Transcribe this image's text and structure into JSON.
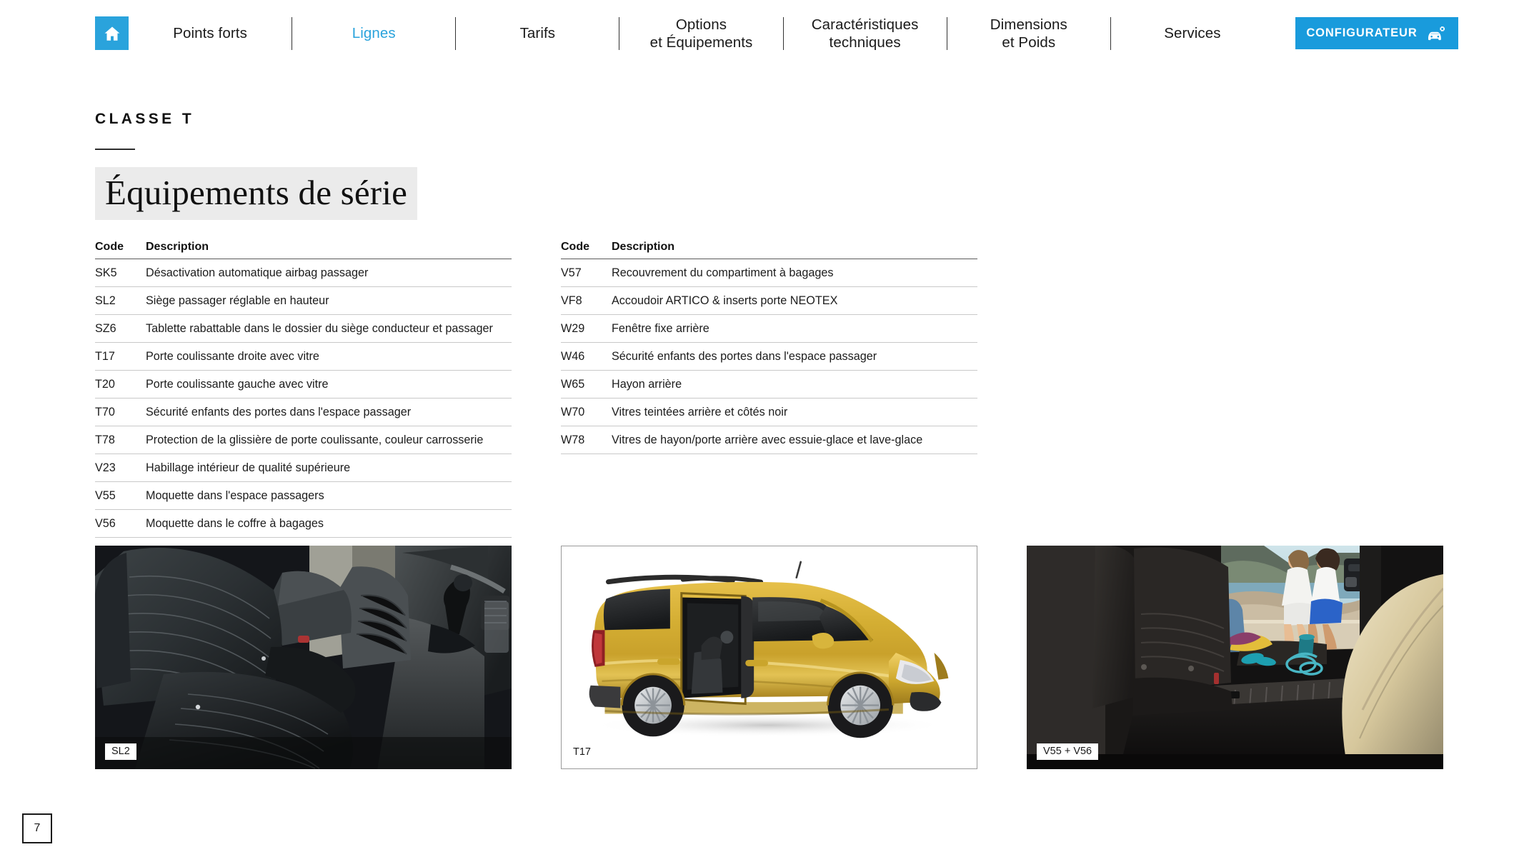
{
  "nav": {
    "home_icon": "home-icon",
    "items": [
      {
        "label": "Points forts",
        "active": false
      },
      {
        "label": "Lignes",
        "active": true
      },
      {
        "label": "Tarifs",
        "active": false
      },
      {
        "label": "Options\net Équipements",
        "active": false
      },
      {
        "label": "Caractéristiques\ntechniques",
        "active": false
      },
      {
        "label": "Dimensions\net Poids",
        "active": false
      },
      {
        "label": "Services",
        "active": false
      }
    ],
    "configurator": {
      "label": "CONFIGURATEUR",
      "icon": "car-gear-icon",
      "bg_color": "#199BDC"
    },
    "accent_color": "#2AA3DC"
  },
  "page": {
    "eyebrow": "CLASSE T",
    "headline": "Équipements de série",
    "headline_bg": "#ebebeb",
    "page_number": "7"
  },
  "tables": [
    {
      "headers": {
        "code": "Code",
        "description": "Description"
      },
      "rows": [
        {
          "code": "SK5",
          "description": "Désactivation automatique airbag passager"
        },
        {
          "code": "SL2",
          "description": "Siège passager réglable en hauteur"
        },
        {
          "code": "SZ6",
          "description": "Tablette rabattable dans le dossier du siège conducteur et passager"
        },
        {
          "code": "T17",
          "description": "Porte coulissante droite avec vitre"
        },
        {
          "code": "T20",
          "description": "Porte coulissante gauche avec vitre"
        },
        {
          "code": "T70",
          "description": "Sécurité enfants des portes dans l'espace passager"
        },
        {
          "code": "T78",
          "description": "Protection de la glissière de porte coulissante, couleur carrosserie"
        },
        {
          "code": "V23",
          "description": "Habillage intérieur de qualité supérieure"
        },
        {
          "code": "V55",
          "description": "Moquette dans l'espace passagers"
        },
        {
          "code": "V56",
          "description": "Moquette dans le coffre à bagages"
        }
      ]
    },
    {
      "headers": {
        "code": "Code",
        "description": "Description"
      },
      "rows": [
        {
          "code": "V57",
          "description": "Recouvrement du compartiment à bagages"
        },
        {
          "code": "VF8",
          "description": "Accoudoir ARTICO & inserts porte NEOTEX"
        },
        {
          "code": "W29",
          "description": "Fenêtre fixe arrière"
        },
        {
          "code": "W46",
          "description": "Sécurité enfants des portes dans l'espace passager"
        },
        {
          "code": "W65",
          "description": "Hayon arrière"
        },
        {
          "code": "W70",
          "description": "Vitres teintées arrière et côtés noir"
        },
        {
          "code": "W78",
          "description": "Vitres de hayon/porte arrière avec essuie-glace et lave-glace"
        }
      ]
    }
  ],
  "photos": [
    {
      "caption": "SL2",
      "alt": "Intérieur sièges avant cuir noir avec levier de vitesses",
      "framed": false
    },
    {
      "caption": "T17",
      "alt": "Van doré vue de profil avec porte coulissante droite ouverte",
      "framed": true
    },
    {
      "caption": "V55 + V56",
      "alt": "Coffre à bagages avec moquette, vue depuis l'intérieur vers la plage",
      "framed": false
    }
  ]
}
